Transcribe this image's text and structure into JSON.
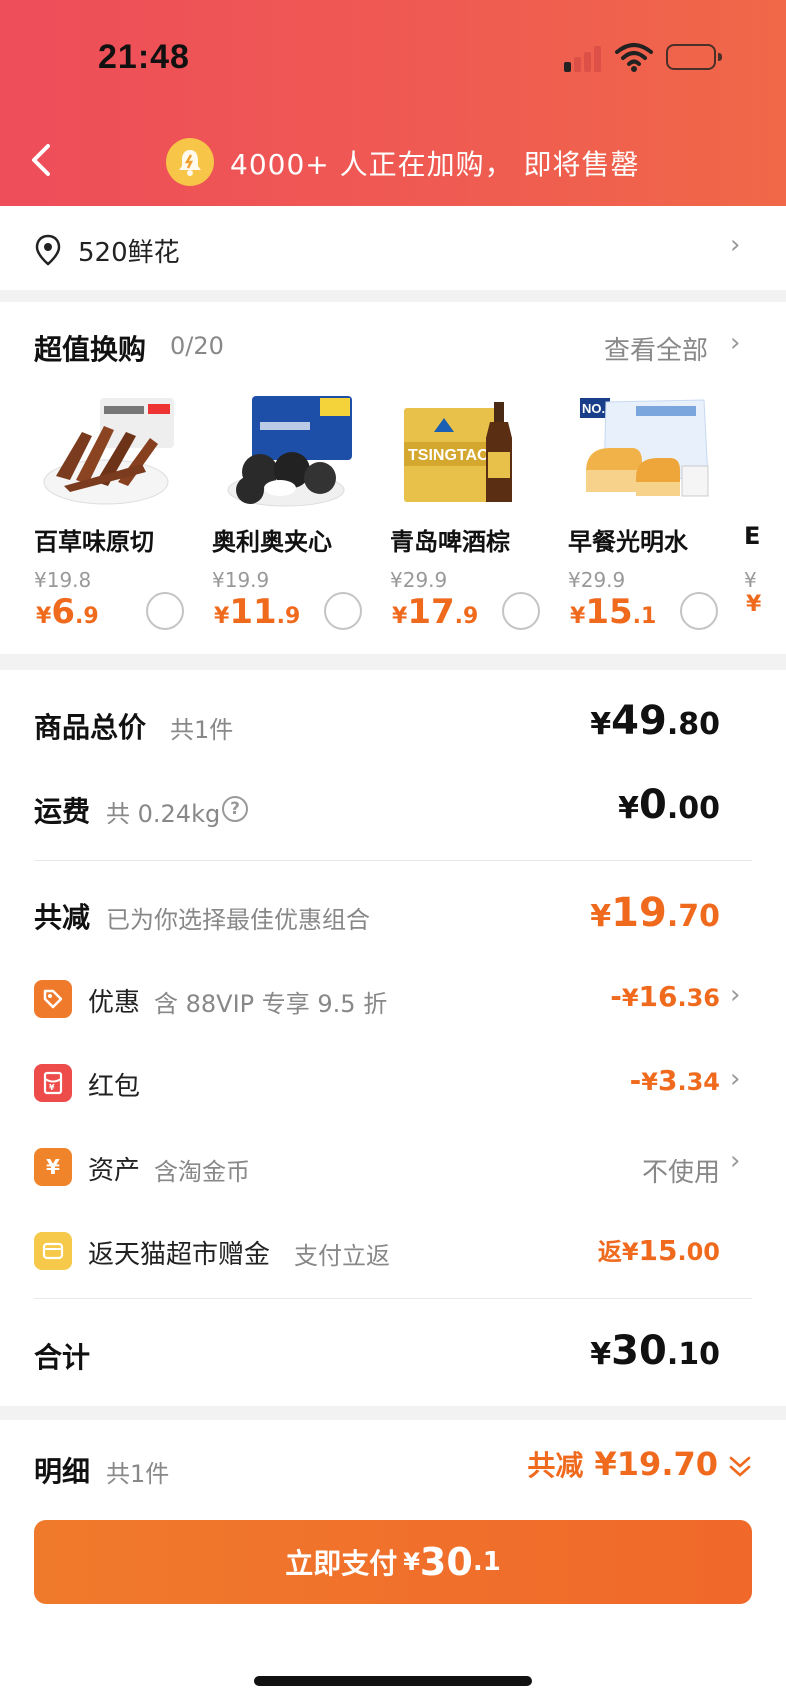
{
  "status_bar": {
    "time": "21:48"
  },
  "header": {
    "banner": "4000+ 人正在加购， 即将售罄"
  },
  "address": {
    "text": "520鲜花"
  },
  "deals": {
    "title": "超值换购",
    "count": "0/20",
    "view_all": "查看全部",
    "items": [
      {
        "name": "百草味原切",
        "orig_price": "¥19.8",
        "price_int": "6",
        "price_dec": ".9"
      },
      {
        "name": "奥利奥夹心",
        "orig_price": "¥19.9",
        "price_int": "11",
        "price_dec": ".9"
      },
      {
        "name": "青岛啤酒棕",
        "orig_price": "¥29.9",
        "price_int": "17",
        "price_dec": ".9"
      },
      {
        "name": "早餐光明水",
        "orig_price": "¥29.9",
        "price_int": "15",
        "price_dec": ".1"
      }
    ],
    "partial_item_char": "E"
  },
  "summary": {
    "goods_total": {
      "label": "商品总价",
      "sub": "共1件",
      "int": "49",
      "dec": ".80"
    },
    "shipping": {
      "label": "运费",
      "sub": "共 0.24kg",
      "int": "0",
      "dec": ".00"
    },
    "total_reduction": {
      "label": "共减",
      "sub": "已为你选择最佳优惠组合",
      "int": "19",
      "dec": ".70"
    },
    "discounts": [
      {
        "label": "优惠",
        "sub": "含 88VIP 专享 9.5 折",
        "prefix": "-",
        "int": "16",
        "dec": ".36",
        "icon": "tag-icon",
        "color": "#f07a2c"
      },
      {
        "label": "红包",
        "sub": "",
        "prefix": "-",
        "int": "3",
        "dec": ".34",
        "icon": "red-envelope-icon",
        "color": "#ee4b4b"
      },
      {
        "label": "资产",
        "sub": "含淘金币",
        "value_text": "不使用",
        "icon": "yen-coin-icon",
        "color": "#f0842a"
      },
      {
        "label": "返天猫超市赠金",
        "sub": "支付立返",
        "prefix": "返",
        "int": "15",
        "dec": ".00",
        "icon": "wallet-icon",
        "color": "#f6c94a"
      }
    ],
    "grand_total": {
      "label": "合计",
      "int": "30",
      "dec": ".10"
    }
  },
  "bottom": {
    "detail_label": "明细",
    "detail_sub": "共1件",
    "reduction_label": "共减",
    "reduction_value": "¥19.70",
    "pay_label": "立即支付",
    "pay_int": "30",
    "pay_dec": ".1"
  },
  "colors": {
    "accent": "#f06a1e",
    "header_red": "#ee4d5a"
  }
}
